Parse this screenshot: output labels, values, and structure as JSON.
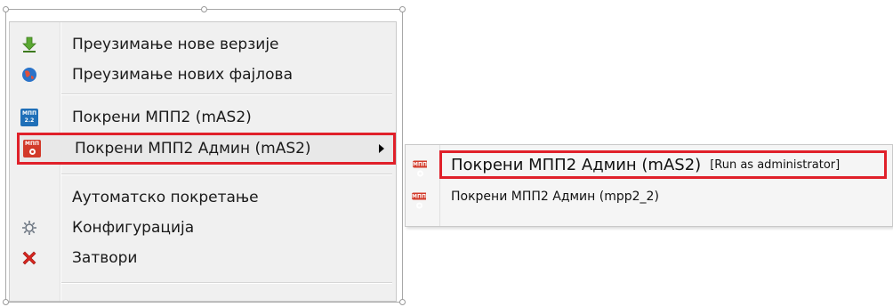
{
  "menu": {
    "items": [
      {
        "label": "Преузимање нове верзије",
        "icon": "download-icon"
      },
      {
        "label": "Преузимање нових фајлова",
        "icon": "globe-icon"
      },
      {
        "label": "Покрени МПП2 (mAS2)",
        "icon": "mpp-app-icon"
      },
      {
        "label": "Покрени МПП2 Админ (mAS2)",
        "icon": "mpp-admin-icon"
      },
      {
        "label": "Аутоматско покретање",
        "icon": ""
      },
      {
        "label": "Конфигурација",
        "icon": "gear-icon"
      },
      {
        "label": "Затвори",
        "icon": "close-icon"
      }
    ],
    "mpp_icon_text": "МПП",
    "mpp_icon_version": "2.2"
  },
  "submenu": {
    "items": [
      {
        "label": "Покрени МПП2 Админ (mAS2)",
        "tag": "[Run as administrator]"
      },
      {
        "label": "Покрени МПП2 Админ (mpp2_2)"
      }
    ]
  },
  "colors": {
    "highlight_border": "#e0202a",
    "mpp_blue": "#1f6fb8",
    "mpp_red": "#d23a2a"
  }
}
